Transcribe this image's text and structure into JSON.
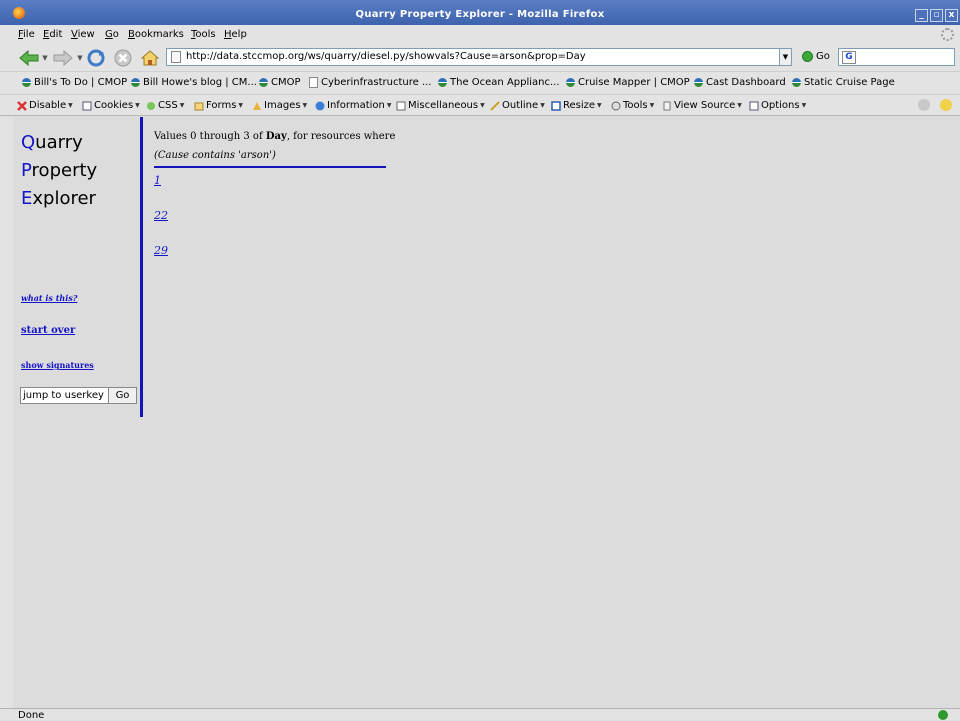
{
  "window": {
    "title": "Quarry Property Explorer - Mozilla Firefox",
    "buttons": [
      "_",
      "▫",
      "x"
    ]
  },
  "menubar": {
    "items": [
      "File",
      "Edit",
      "View",
      "Go",
      "Bookmarks",
      "Tools",
      "Help"
    ],
    "accelerators": [
      "F",
      "E",
      "V",
      "G",
      "B",
      "T",
      "H"
    ]
  },
  "navbar": {
    "url": "http://data.stccmop.org/ws/quarry/diesel.py/showvals?Cause=arson&prop=Day",
    "go_label": "Go",
    "search_value": ""
  },
  "bookmarks": [
    {
      "label": "Bill's To Do | CMOP",
      "icon": "cmop-icon"
    },
    {
      "label": "Bill Howe's blog | CM...",
      "icon": "cmop-icon"
    },
    {
      "label": "CMOP",
      "icon": "cmop-icon"
    },
    {
      "label": "Cyberinfrastructure ...",
      "icon": "page-icon"
    },
    {
      "label": "The Ocean Applianc...",
      "icon": "cmop-icon"
    },
    {
      "label": "Cruise Mapper | CMOP",
      "icon": "cmop-icon"
    },
    {
      "label": "Cast Dashboard",
      "icon": "cmop-icon"
    },
    {
      "label": "Static Cruise Page",
      "icon": "cmop-icon"
    }
  ],
  "devtoolbar": [
    "Disable",
    "Cookies",
    "CSS",
    "Forms",
    "Images",
    "Information",
    "Miscellaneous",
    "Outline",
    "Resize",
    "Tools",
    "View Source",
    "Options"
  ],
  "sidebar": {
    "logo": [
      {
        "cap": "Q",
        "rest": "uarry"
      },
      {
        "cap": "P",
        "rest": "roperty"
      },
      {
        "cap": "E",
        "rest": "xplorer"
      }
    ],
    "what_is_this": "what is this?",
    "start_over": "start over",
    "show_signatures": "show signatures",
    "jump_value": "jump to userkey",
    "jump_button": "Go"
  },
  "main": {
    "heading_prefix": "Values 0 through 3 of ",
    "heading_prop": "Day",
    "heading_suffix": ", for resources where",
    "constraint": "(Cause contains 'arson')",
    "values": [
      "1",
      "22",
      "29"
    ]
  },
  "status": {
    "text": "Done"
  }
}
